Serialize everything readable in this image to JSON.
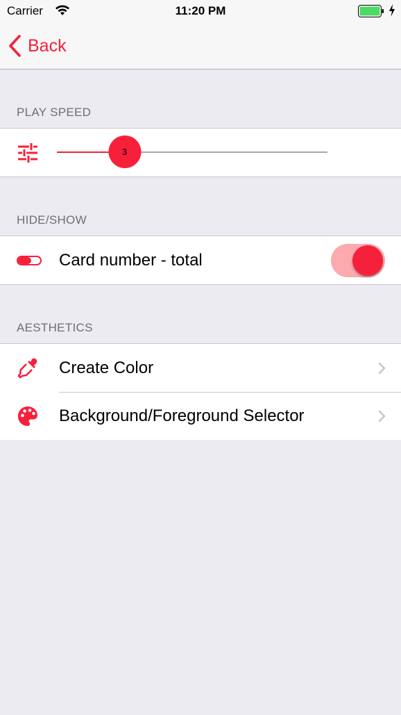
{
  "status_bar": {
    "carrier": "Carrier",
    "time": "11:20 PM"
  },
  "nav": {
    "back_label": "Back"
  },
  "sections": {
    "play_speed": {
      "header": "PLAY SPEED",
      "slider": {
        "value_label": "3",
        "fill_fraction": 0.25
      }
    },
    "hide_show": {
      "header": "HIDE/SHOW",
      "card_number_label": "Card number - total",
      "toggle_on": true
    },
    "aesthetics": {
      "header": "AESTHETICS",
      "items": [
        {
          "label": "Create Color",
          "icon": "eyedropper-icon"
        },
        {
          "label": "Background/Foreground Selector",
          "icon": "palette-icon"
        }
      ]
    }
  },
  "colors": {
    "accent": "#f7203a",
    "accent_light": "#fcaaad",
    "background": "#ebebf1"
  }
}
